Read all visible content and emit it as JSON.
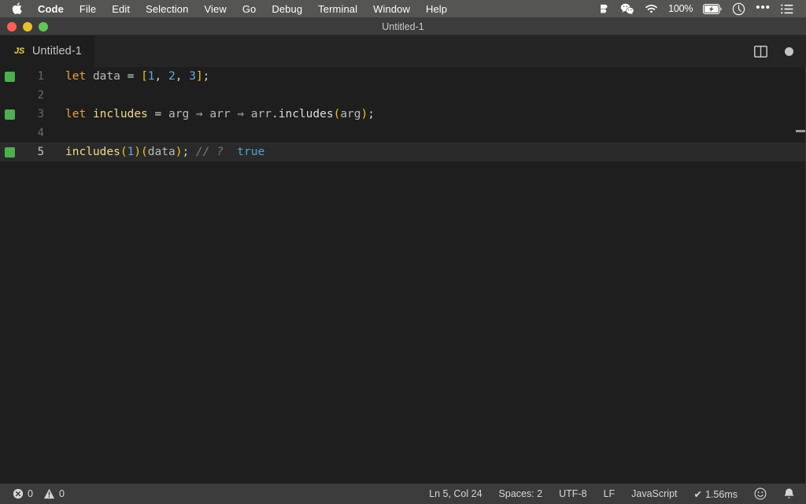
{
  "menubar": {
    "apple_icon": "apple-logo-icon",
    "items": [
      {
        "label": "Code",
        "bold": true
      },
      {
        "label": "File",
        "bold": false
      },
      {
        "label": "Edit",
        "bold": false
      },
      {
        "label": "Selection",
        "bold": false
      },
      {
        "label": "View",
        "bold": false
      },
      {
        "label": "Go",
        "bold": false
      },
      {
        "label": "Debug",
        "bold": false
      },
      {
        "label": "Terminal",
        "bold": false
      },
      {
        "label": "Window",
        "bold": false
      },
      {
        "label": "Help",
        "bold": false
      }
    ],
    "tray": {
      "dropbox_icon": "dropbox-icon",
      "wechat_icon": "wechat-icon",
      "wifi_icon": "wifi-icon",
      "battery_percent": "100%",
      "battery_icon": "battery-charging-icon",
      "clock_icon": "clock-icon",
      "control_center_icon": "ellipsis-icon",
      "notification_center_icon": "list-icon"
    }
  },
  "window": {
    "title": "Untitled-1",
    "traffic_lights": {
      "close": "close-button",
      "minimize": "minimize-button",
      "maximize": "maximize-button"
    },
    "colors": {
      "close": "#ff5f57",
      "minimize": "#e6c029",
      "maximize": "#62c554"
    }
  },
  "tabbar": {
    "tabs": [
      {
        "badge": "JS",
        "label": "Untitled-1",
        "active": true,
        "dirty": true
      }
    ],
    "split_editor_icon": "split-editor-icon",
    "more_actions_icon": "dirty-dot-icon"
  },
  "editor": {
    "language": "JavaScript",
    "lines": [
      {
        "number": "1",
        "marker": true,
        "active": false,
        "tokens": [
          {
            "text": "let",
            "cls": "t-kw"
          },
          {
            "text": " ",
            "cls": "t-plain"
          },
          {
            "text": "data",
            "cls": "t-var"
          },
          {
            "text": " = ",
            "cls": "t-plain"
          },
          {
            "text": "[",
            "cls": "t-bracket"
          },
          {
            "text": "1",
            "cls": "t-num"
          },
          {
            "text": ", ",
            "cls": "t-punct"
          },
          {
            "text": "2",
            "cls": "t-num"
          },
          {
            "text": ", ",
            "cls": "t-punct"
          },
          {
            "text": "3",
            "cls": "t-num"
          },
          {
            "text": "]",
            "cls": "t-bracket"
          },
          {
            "text": ";",
            "cls": "t-punct"
          }
        ]
      },
      {
        "number": "2",
        "marker": false,
        "active": false,
        "tokens": []
      },
      {
        "number": "3",
        "marker": true,
        "active": false,
        "tokens": [
          {
            "text": "let",
            "cls": "t-kw"
          },
          {
            "text": " ",
            "cls": "t-plain"
          },
          {
            "text": "includes",
            "cls": "t-fn"
          },
          {
            "text": " = ",
            "cls": "t-plain"
          },
          {
            "text": "arg",
            "cls": "t-var"
          },
          {
            "text": " ⇒ ",
            "cls": "t-arrow"
          },
          {
            "text": "arr",
            "cls": "t-var"
          },
          {
            "text": " ⇒ ",
            "cls": "t-arrow"
          },
          {
            "text": "arr",
            "cls": "t-var"
          },
          {
            "text": ".",
            "cls": "t-punct"
          },
          {
            "text": "includes",
            "cls": "t-prop"
          },
          {
            "text": "(",
            "cls": "t-bracket"
          },
          {
            "text": "arg",
            "cls": "t-var"
          },
          {
            "text": ")",
            "cls": "t-bracket"
          },
          {
            "text": ";",
            "cls": "t-punct"
          }
        ]
      },
      {
        "number": "4",
        "marker": false,
        "active": false,
        "tokens": []
      },
      {
        "number": "5",
        "marker": true,
        "active": true,
        "tokens": [
          {
            "text": "includes",
            "cls": "t-fn"
          },
          {
            "text": "(",
            "cls": "t-bracket"
          },
          {
            "text": "1",
            "cls": "t-num"
          },
          {
            "text": ")",
            "cls": "t-bracket"
          },
          {
            "text": "(",
            "cls": "t-bracket"
          },
          {
            "text": "data",
            "cls": "t-var"
          },
          {
            "text": ")",
            "cls": "t-bracket"
          },
          {
            "text": ";",
            "cls": "t-punct"
          },
          {
            "text": " // ?",
            "cls": "t-comment"
          },
          {
            "text": "  true",
            "cls": "t-result"
          }
        ]
      }
    ],
    "gutter_marker_color": "#4caf50"
  },
  "statusbar": {
    "errors": {
      "icon": "error-icon",
      "count": "0"
    },
    "warnings": {
      "icon": "warning-icon",
      "count": "0"
    },
    "cursor_position": "Ln 5, Col 24",
    "indentation": "Spaces: 2",
    "encoding": "UTF-8",
    "eol": "LF",
    "language_mode": "JavaScript",
    "runtime": {
      "glyph": "✔",
      "text": "1.56ms"
    },
    "feedback_icon": "smiley-icon",
    "notifications_icon": "bell-icon"
  }
}
